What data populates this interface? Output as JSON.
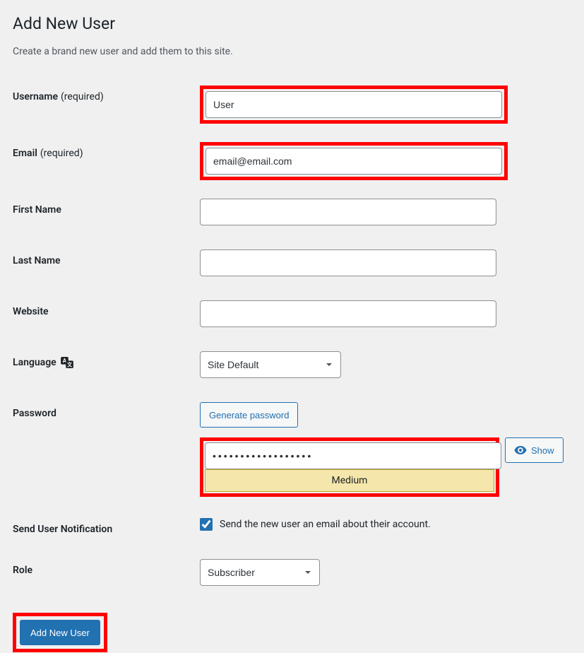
{
  "page": {
    "title": "Add New User",
    "description": "Create a brand new user and add them to this site."
  },
  "form": {
    "username": {
      "label": "Username",
      "required_text": "(required)",
      "value": "User"
    },
    "email": {
      "label": "Email",
      "required_text": "(required)",
      "value": "email@email.com"
    },
    "first_name": {
      "label": "First Name",
      "value": ""
    },
    "last_name": {
      "label": "Last Name",
      "value": ""
    },
    "website": {
      "label": "Website",
      "value": ""
    },
    "language": {
      "label": "Language",
      "value": "Site Default"
    },
    "password": {
      "label": "Password",
      "generate_button": "Generate password",
      "value": "••••••••••••••••••",
      "strength": "Medium",
      "show_button": "Show"
    },
    "notification": {
      "label": "Send User Notification",
      "checkbox_label": "Send the new user an email about their account.",
      "checked": true
    },
    "role": {
      "label": "Role",
      "value": "Subscriber"
    },
    "submit": {
      "label": "Add New User"
    }
  }
}
